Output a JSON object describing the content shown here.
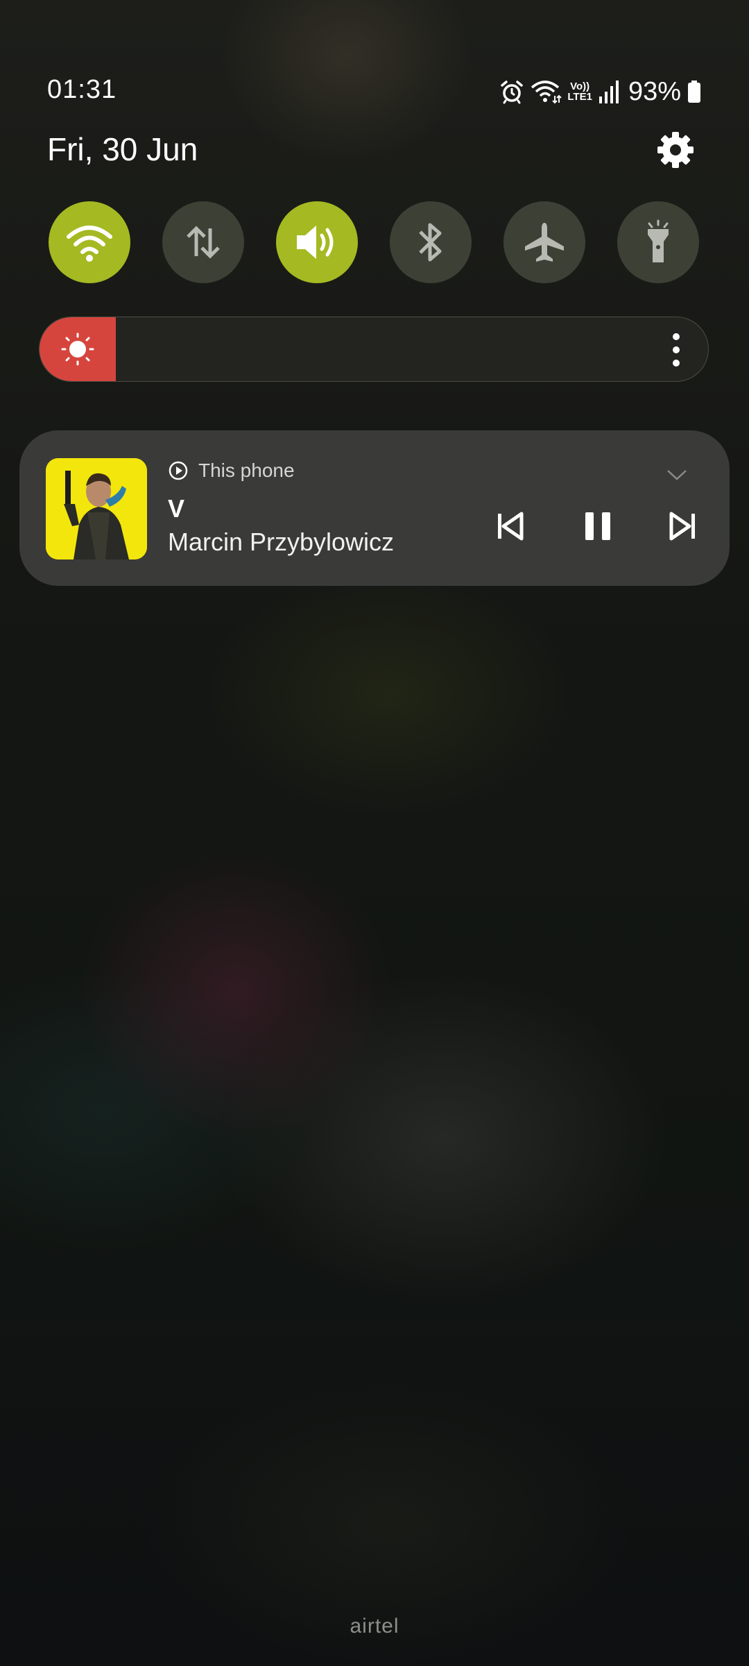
{
  "status_bar": {
    "time": "01:31",
    "network_label_top": "Vo))",
    "network_label_bottom": "LTE1",
    "battery": "93%"
  },
  "header": {
    "date": "Fri, 30 Jun"
  },
  "quick_settings": [
    {
      "name": "wifi-icon",
      "on": true
    },
    {
      "name": "mobile-data-icon",
      "on": false
    },
    {
      "name": "sound-icon",
      "on": true
    },
    {
      "name": "bluetooth-icon",
      "on": false
    },
    {
      "name": "airplane-icon",
      "on": false
    },
    {
      "name": "flashlight-icon",
      "on": false
    }
  ],
  "brightness": {
    "level": 0.0
  },
  "media": {
    "source": "This phone",
    "title": "V",
    "artist": "Marcin Przybylowicz"
  },
  "footer": {
    "carrier": "airtel"
  },
  "colors": {
    "accent_on": "#a5b922",
    "tile_off": "#3d4035",
    "brightness_red": "#d6453d",
    "media_card": "#3a3a38"
  }
}
